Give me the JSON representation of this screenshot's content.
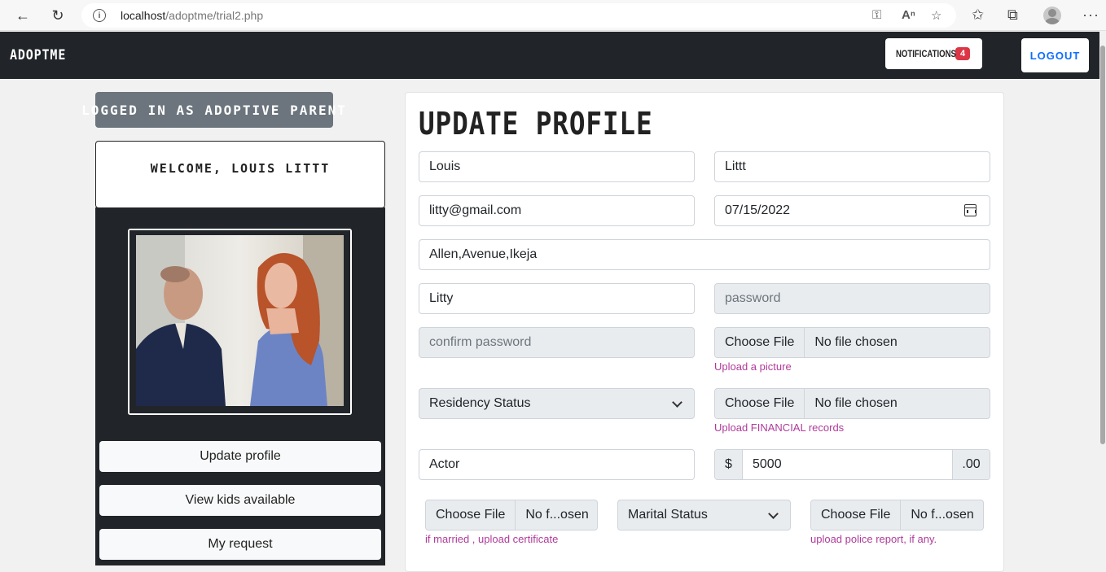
{
  "browser": {
    "url_host": "localhost",
    "url_path": "/adoptme/trial2.php"
  },
  "navbar": {
    "brand": "ADOPTME",
    "notifications_label": "NOTIFICATIONS",
    "notifications_count": "4",
    "logout_label": "LOGOUT"
  },
  "sidebar": {
    "role": "LOGGED IN AS ADOPTIVE PARENT",
    "welcome": "WELCOME, LOUIS LITTT",
    "buttons": [
      "Update profile",
      "View kids available",
      "My request"
    ]
  },
  "form": {
    "title": "UPDATE PROFILE",
    "first_name": "Louis",
    "last_name": "Littt",
    "email": "litty@gmail.com",
    "dob": "07/15/2022",
    "address": "Allen,Avenue,Ikeja",
    "username": "Litty",
    "password_placeholder": "password",
    "confirm_password_placeholder": "confirm password",
    "file_button_label": "Choose File",
    "no_file": "No file chosen",
    "no_file_short": "No f...osen",
    "picture_help": "Upload a picture",
    "residency_select": "Residency Status",
    "financial_help": "Upload FINANCIAL records",
    "occupation": "Actor",
    "currency_prefix": "$",
    "income": "5000",
    "currency_suffix": ".00",
    "marital_select": "Marital Status",
    "marriage_help": "if married , upload certificate",
    "police_help": "upload police report, if any."
  }
}
